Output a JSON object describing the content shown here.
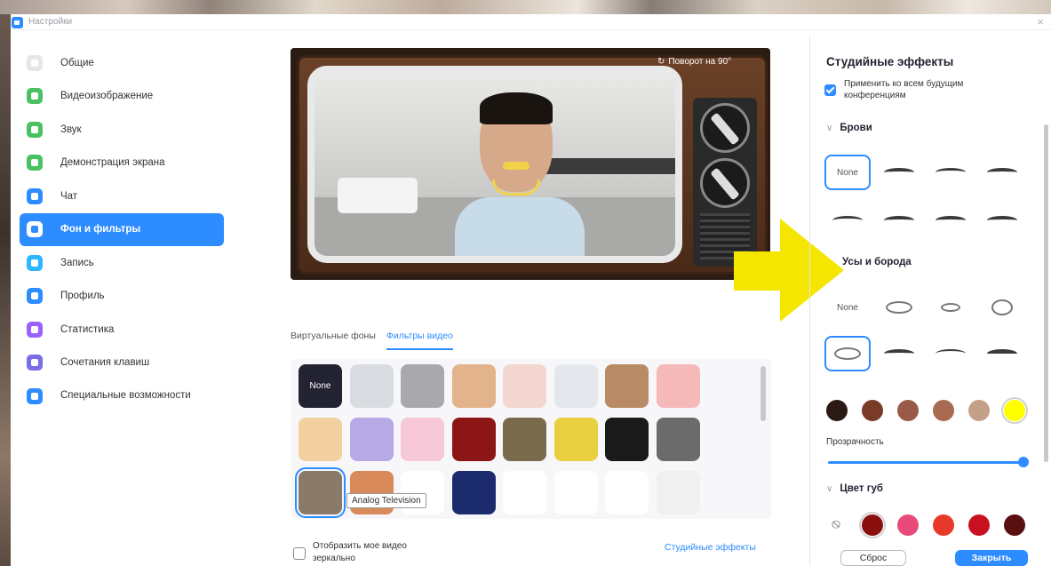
{
  "window": {
    "title": "Настройки",
    "close_glyph": "×"
  },
  "sidebar": {
    "items": [
      {
        "label": "Общие",
        "color": "#e6e6ea",
        "active": false
      },
      {
        "label": "Видеоизображение",
        "color": "#4ac262",
        "active": false
      },
      {
        "label": "Звук",
        "color": "#4ac262",
        "active": false
      },
      {
        "label": "Демонстрация экрана",
        "color": "#4ac262",
        "active": false
      },
      {
        "label": "Чат",
        "color": "#2d8cff",
        "active": false
      },
      {
        "label": "Фон и фильтры",
        "color": "#2d8cff",
        "active": true
      },
      {
        "label": "Запись",
        "color": "#2db7ff",
        "active": false
      },
      {
        "label": "Профиль",
        "color": "#2d8cff",
        "active": false
      },
      {
        "label": "Статистика",
        "color": "#9b61ff",
        "active": false
      },
      {
        "label": "Сочетания клавиш",
        "color": "#7a6ee8",
        "active": false
      },
      {
        "label": "Специальные возможности",
        "color": "#2d8cff",
        "active": false
      }
    ]
  },
  "preview": {
    "rotate_label": "Поворот на 90°"
  },
  "tabs": [
    {
      "label": "Виртуальные фоны",
      "active": false
    },
    {
      "label": "Фильтры видео",
      "active": true
    }
  ],
  "filters": {
    "none_label": "None",
    "tooltip": "Analog Television",
    "rows": [
      [
        "#232333",
        "#d9dde2",
        "#a9a9ab",
        "#e3b48c",
        "#f4d6d0",
        "#e4e8ec",
        "#b98a66",
        "#f6b9b9"
      ],
      [
        "#f2d0a0",
        "#b7a8e6",
        "#f7c8d8",
        "#8c1616",
        "#7a6b4c",
        "#e8d040",
        "#1a1a1a",
        "#6b6b6b"
      ],
      [
        "#8a7a6a",
        "#d88a5a",
        "#ffffff",
        "#1c2a6e",
        "#ffffff",
        "#ffffff",
        "#ffffff",
        "#f0f0f0"
      ]
    ]
  },
  "mirror": {
    "label": "Отобразить мое видео зеркально"
  },
  "studio_link": "Студийные эффекты",
  "right_panel": {
    "title": "Студийные эффекты",
    "apply_label": "Применить ко всем будущим конференциям",
    "brows_label": "Брови",
    "beard_label": "Усы и борода",
    "none_label": "None",
    "opacity_label": "Прозрачность",
    "lips_label": "Цвет губ",
    "beard_colors": [
      "#2b1a14",
      "#7a3a28",
      "#9a5a48",
      "#a86a50",
      "#c4a088",
      "#ffff00"
    ],
    "lip_colors": [
      "#8a1010",
      "#e84a7a",
      "#e83a2a",
      "#c81020",
      "#5a1010"
    ],
    "reset_label": "Сброс",
    "close_label": "Закрыть"
  }
}
